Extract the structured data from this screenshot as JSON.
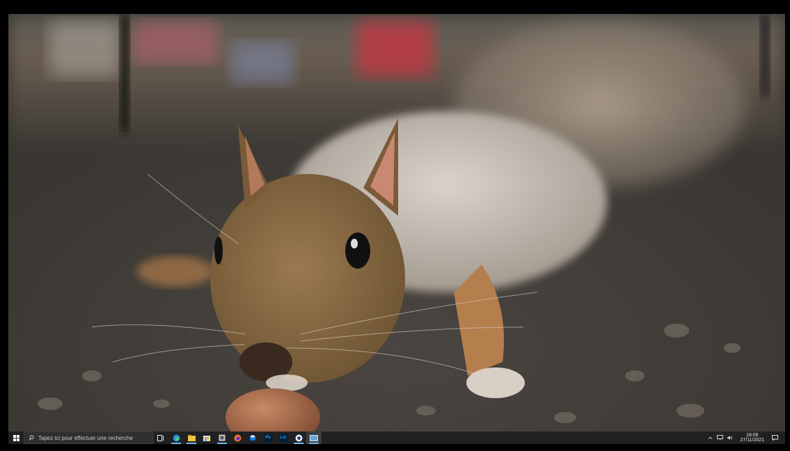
{
  "taskbar": {
    "search_placeholder": "Tapez ici pour effectuer une recherche",
    "pinned": [
      {
        "name": "task-view-icon"
      },
      {
        "name": "edge-icon"
      },
      {
        "name": "file-explorer-icon"
      },
      {
        "name": "store-icon"
      },
      {
        "name": "app-window-icon"
      },
      {
        "name": "firefox-icon"
      },
      {
        "name": "app-icon"
      },
      {
        "name": "photoshop-icon",
        "label": "Ps"
      },
      {
        "name": "lightroom-icon",
        "label": "LrC"
      },
      {
        "name": "chrome-like-icon"
      },
      {
        "name": "media-player-icon"
      }
    ],
    "tray": {
      "time": "18:06",
      "date": "27/11/2021"
    }
  },
  "colors": {
    "taskbar_bg": "#1f2122",
    "accent": "#76b9ed",
    "photoshop": "#31a8ff",
    "lightroom": "#31a8ff"
  }
}
